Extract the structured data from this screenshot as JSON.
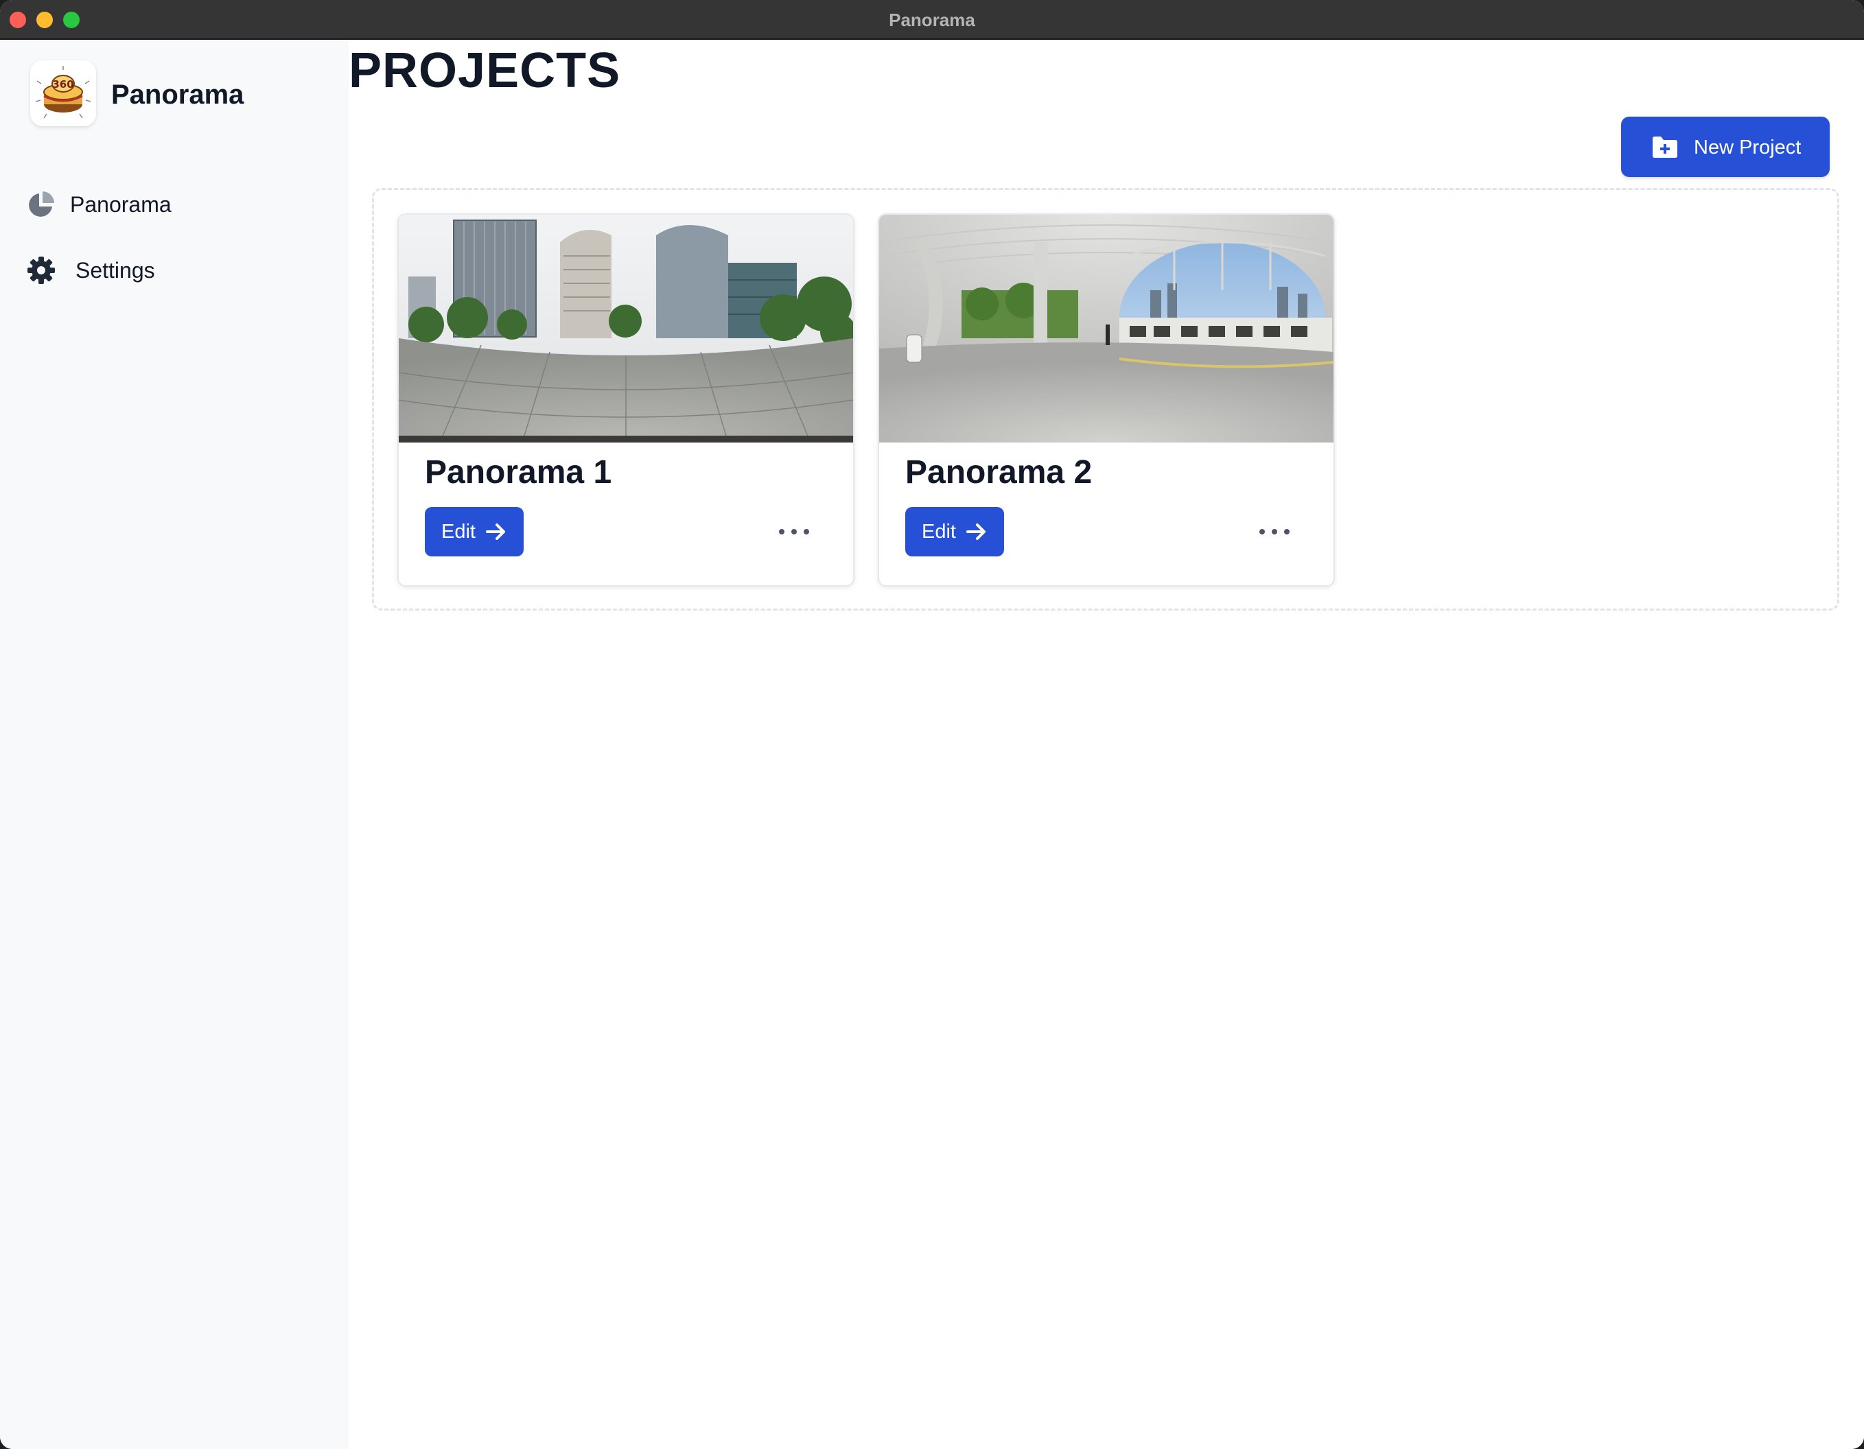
{
  "window": {
    "title": "Panorama"
  },
  "sidebar": {
    "app_name": "Panorama",
    "logo_text": "360",
    "items": [
      {
        "label": "Panorama",
        "icon": "pie-chart-icon"
      },
      {
        "label": "Settings",
        "icon": "gear-icon"
      }
    ]
  },
  "main": {
    "title": "PROJECTS",
    "new_project_label": "New Project",
    "projects": [
      {
        "title": "Panorama 1",
        "edit_label": "Edit",
        "thumbnail": "city-plaza-equirectangular"
      },
      {
        "title": "Panorama 2",
        "edit_label": "Edit",
        "thumbnail": "train-station-equirectangular"
      }
    ]
  },
  "colors": {
    "accent": "#2650d6",
    "sidebar_bg": "#f8f9fb",
    "titlebar_bg": "#353535",
    "text": "#111827"
  }
}
